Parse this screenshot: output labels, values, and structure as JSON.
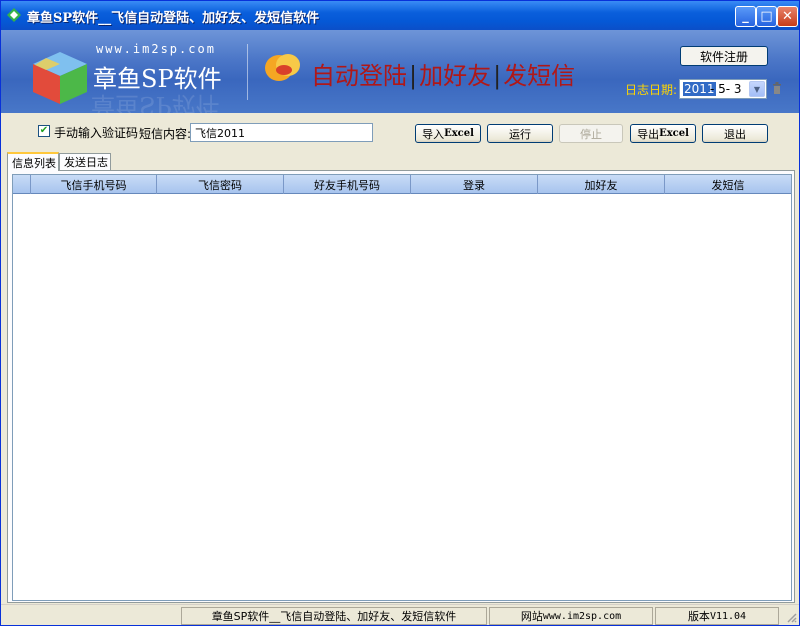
{
  "window": {
    "title": "章鱼SP软件__飞信自动登陆、加好友、发短信软件",
    "controls": {
      "minimize": "_",
      "maximize": "□",
      "close": "✕"
    }
  },
  "banner": {
    "url": "www.im2sp.com",
    "brand": "章鱼SP软件",
    "slogan": [
      "自动登陆",
      "加好友",
      "发短信"
    ],
    "slogan_separator": "|",
    "register_button": "软件注册",
    "log_date_label": "日志日期:",
    "log_date": {
      "year": "2011",
      "rest": "- 5- 3"
    },
    "colors": {
      "slogan": "#b01818",
      "date_label": "#ffd700"
    }
  },
  "toolbar": {
    "manual_captcha_label": "手动输入验证码",
    "manual_captcha_checked": true,
    "sms_label": "短信内容:",
    "sms_value": "飞信2011",
    "buttons": {
      "import": {
        "prefix": "导入",
        "en": "Excel"
      },
      "run": "运行",
      "stop": "停止",
      "export": {
        "prefix": "导出",
        "en": "Excel"
      },
      "exit": "退出"
    }
  },
  "tabs": [
    "信息列表",
    "发送日志"
  ],
  "table": {
    "columns": [
      "飞信手机号码",
      "飞信密码",
      "好友手机号码",
      "登录",
      "加好友",
      "发短信"
    ],
    "rows": []
  },
  "statusbar": {
    "app": "章鱼SP软件__飞信自动登陆、加好友、发短信软件",
    "website_label": "网站",
    "website": "www.im2sp.com",
    "version_label": "版本",
    "version": "V11.04"
  }
}
